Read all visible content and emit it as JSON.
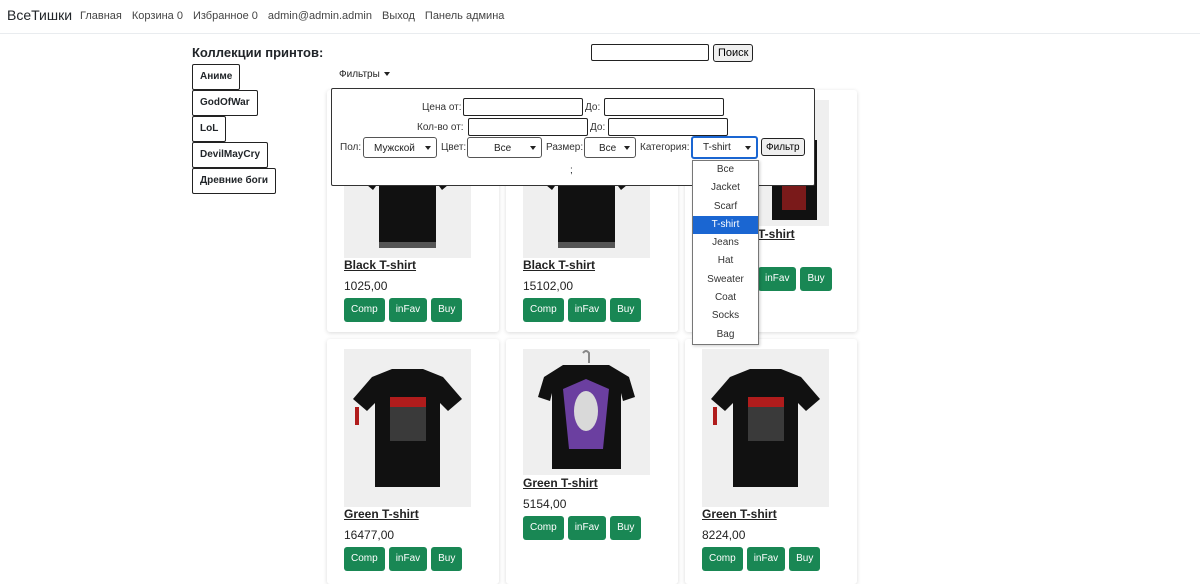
{
  "nav": {
    "brand": "ВсеТишки",
    "links": [
      "Главная",
      "Корзина 0",
      "Избранное 0",
      "admin@admin.admin",
      "Выход",
      "Панель админа"
    ]
  },
  "search": {
    "button": "Поиск",
    "value": ""
  },
  "collections": {
    "title": "Коллекции принтов:",
    "items": [
      "Аниме",
      "GodOfWar",
      "LoL",
      "DevilMayCry",
      "Древние боги"
    ]
  },
  "filters": {
    "toggle": "Фильтры",
    "price_from": "Цена от:",
    "price_to": "До:",
    "qty_from": "Кол-во от:",
    "qty_to": "До:",
    "gender_label": "Пол:",
    "gender_value": "Мужской",
    "color_label": "Цвет:",
    "color_value": "Все",
    "size_label": "Размер:",
    "size_value": "Все",
    "category_label": "Категория:",
    "category_value": "T-shirt",
    "button": "Фильтр",
    "footer": ";"
  },
  "category_options": [
    "Все",
    "Jacket",
    "Scarf",
    "T-shirt",
    "Jeans",
    "Hat",
    "Sweater",
    "Coat",
    "Socks",
    "Bag"
  ],
  "selected_category_index": 3,
  "products": [
    {
      "title": "Black T-shirt",
      "price": "1025,00"
    },
    {
      "title": "Black T-shirt",
      "price": "15102,00"
    },
    {
      "title": "T-shirt",
      "price": ""
    },
    {
      "title": "Green T-shirt",
      "price": "16477,00"
    },
    {
      "title": "Green T-shirt",
      "price": "5154,00"
    },
    {
      "title": "Green T-shirt",
      "price": "8224,00"
    }
  ],
  "product_buttons": {
    "comp": "Comp",
    "fav": "inFav",
    "buy": "Buy"
  },
  "colors": {
    "accent_green": "#198754",
    "focus_blue": "#1a66d2"
  }
}
